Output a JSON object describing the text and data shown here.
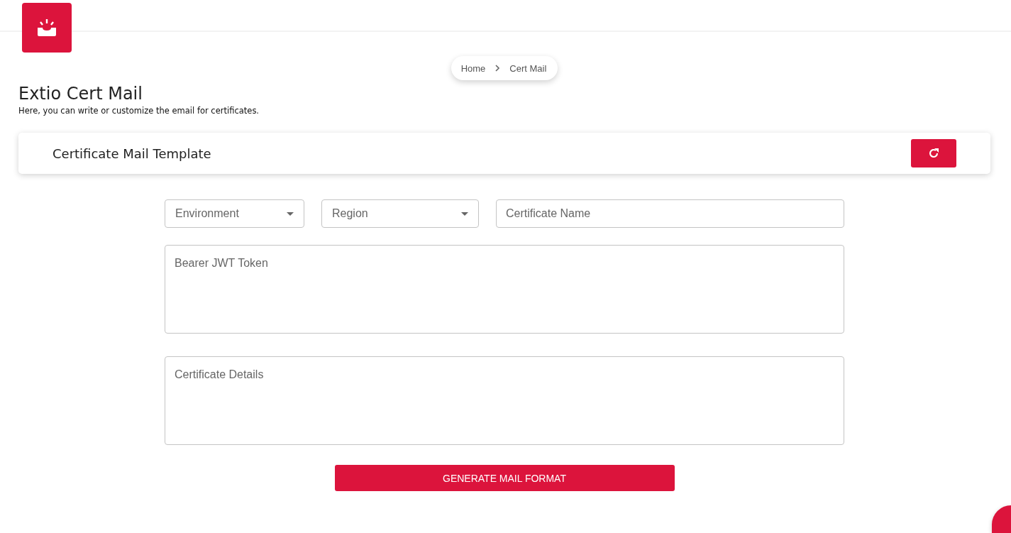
{
  "breadcrumb": [
    "Home",
    "Cert Mail"
  ],
  "page": {
    "title": "Extio Cert Mail",
    "subtitle": "Here, you can write or customize the email for certificates."
  },
  "card": {
    "title": "Certificate Mail Template"
  },
  "fields": [
    {
      "kind": "select",
      "placeholder": "Environment"
    },
    {
      "kind": "select",
      "placeholder": "Region"
    },
    {
      "kind": "text",
      "placeholder": "Certificate Name"
    },
    {
      "kind": "textarea",
      "placeholder": "Bearer JWT Token"
    },
    {
      "kind": "textarea",
      "placeholder": "Certificate Details"
    }
  ],
  "primary_button": {
    "label": "GENERATE MAIL FORMAT"
  }
}
